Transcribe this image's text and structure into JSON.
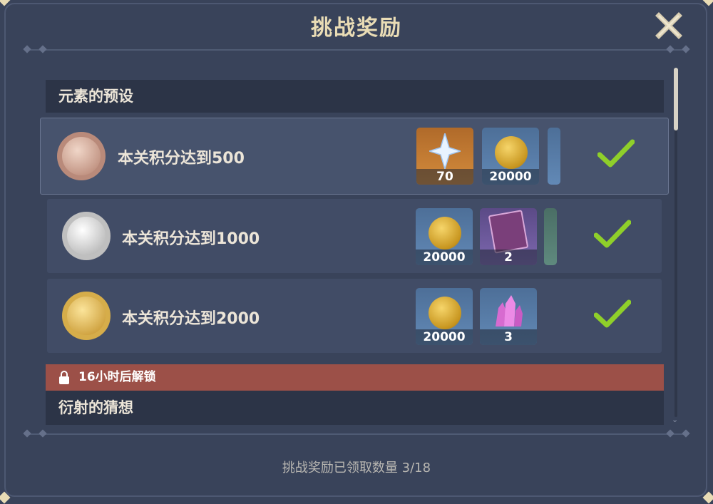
{
  "title": "挑战奖励",
  "sections": [
    {
      "name": "元素的预设",
      "tasks": [
        {
          "goal": "本关积分达到500",
          "medal": "bronze",
          "rewards": [
            {
              "icon": "primogem-icon",
              "qty": "70"
            },
            {
              "icon": "mora-coin-icon",
              "qty": "20000"
            }
          ]
        },
        {
          "goal": "本关积分达到1000",
          "medal": "silver",
          "rewards": [
            {
              "icon": "mora-coin-icon",
              "qty": "20000"
            },
            {
              "icon": "heros-wit-book-icon",
              "qty": "2"
            }
          ]
        },
        {
          "goal": "本关积分达到2000",
          "medal": "gold",
          "rewards": [
            {
              "icon": "mora-coin-icon",
              "qty": "20000"
            },
            {
              "icon": "crystal-ore-icon",
              "qty": "3"
            }
          ]
        }
      ]
    },
    {
      "name": "衍射的猜想",
      "lock_text": "16小时后解锁"
    }
  ],
  "footer": "挑战奖励已领取数量 3/18",
  "colors": {
    "accent": "#e9dcb5",
    "check": "#8fcf2a",
    "lock_bar": "#9c5048"
  }
}
